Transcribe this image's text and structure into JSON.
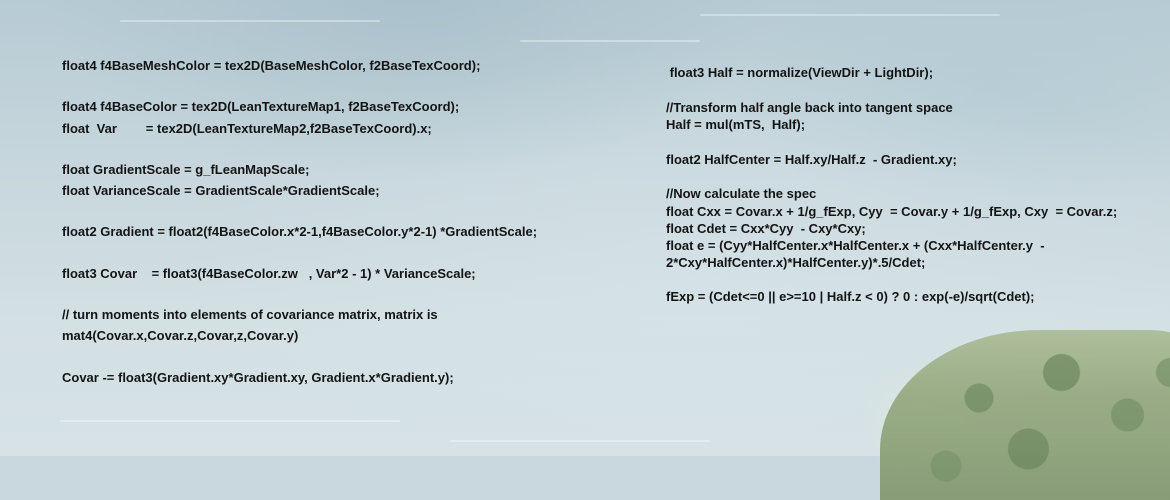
{
  "left_code": [
    "float4 f4BaseMeshColor = tex2D(BaseMeshColor, f2BaseTexCoord);",
    "float4 f4BaseColor = tex2D(LeanTextureMap1, f2BaseTexCoord);",
    "float  Var        = tex2D(LeanTextureMap2,f2BaseTexCoord).x;",
    "float GradientScale = g_fLeanMapScale;",
    "float VarianceScale = GradientScale*GradientScale;",
    "float2 Gradient = float2(f4BaseColor.x*2-1,f4BaseColor.y*2-1) *GradientScale;",
    "float3 Covar    = float3(f4BaseColor.zw   , Var*2 - 1) * VarianceScale;",
    "// turn moments into elements of covariance matrix, matrix is",
    "mat4(Covar.x,Covar.z,Covar,z,Covar.y)",
    "Covar -= float3(Gradient.xy*Gradient.xy, Gradient.x*Gradient.y);"
  ],
  "right_code": [
    " float3 Half = normalize(ViewDir + LightDir);",
    "//Transform half angle back into tangent space",
    "Half = mul(mTS,  Half);",
    "float2 HalfCenter = Half.xy/Half.z  - Gradient.xy;",
    "//Now calculate the spec",
    "float Cxx = Covar.x + 1/g_fExp, Cyy  = Covar.y + 1/g_fExp, Cxy  = Covar.z;",
    "float Cdet = Cxx*Cyy  - Cxy*Cxy;",
    "float e = (Cyy*HalfCenter.x*HalfCenter.x + (Cxx*HalfCenter.y  -",
    "2*Cxy*HalfCenter.x)*HalfCenter.y)*.5/Cdet;",
    "fExp = (Cdet<=0 || e>=10 | Half.z < 0) ? 0 : exp(-e)/sqrt(Cdet);"
  ]
}
